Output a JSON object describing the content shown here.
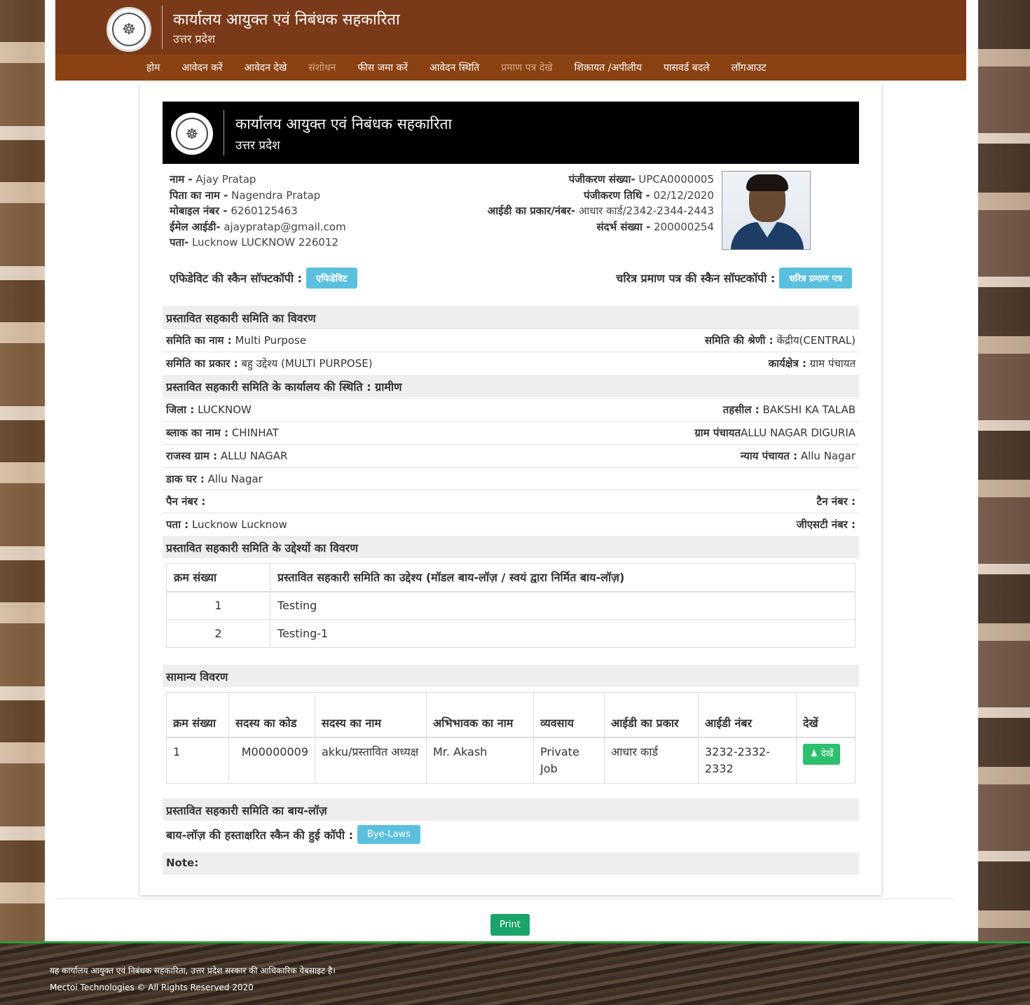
{
  "header": {
    "title": "कार्यालय आयुक्त एवं निबंधक सहकारिता",
    "subtitle": "उत्तर प्रदेश",
    "emblem_icon": "up-government-emblem"
  },
  "nav": [
    {
      "label": "होम",
      "dim": false
    },
    {
      "label": "आवेदन करें",
      "dim": false
    },
    {
      "label": "आवेदन देखे",
      "dim": false
    },
    {
      "label": "संशोधन",
      "dim": true
    },
    {
      "label": "फीस जमा करें",
      "dim": false
    },
    {
      "label": "आवेदन स्थिति",
      "dim": false
    },
    {
      "label": "प्रमाण पत्र देखे",
      "dim": true
    },
    {
      "label": "शिकायत /अपीलीय",
      "dim": false
    },
    {
      "label": "पासवर्ड बदले",
      "dim": false
    },
    {
      "label": "लॉगआउट",
      "dim": false
    }
  ],
  "card_header": {
    "title": "कार्यालय आयुक्त एवं निबंधक सहकारिता",
    "subtitle": "उत्तर प्रदेश"
  },
  "applicant": {
    "name_label": "नाम -",
    "name": "Ajay Pratap",
    "father_label": "पिता का नाम -",
    "father": "Nagendra Pratap",
    "mobile_label": "मोबाइल नंबर -",
    "mobile": "6260125463",
    "email_label": "ईमेल आईडी-",
    "email": "ajaypratap@gmail.com",
    "address_label": "पता-",
    "address": "Lucknow LUCKNOW 226012",
    "reg_no_label": "पंजीकरण संख्या-",
    "reg_no": "UPCA0000005",
    "reg_date_label": "पंजीकरण तिथि -",
    "reg_date": "02/12/2020",
    "id_label": "आईडी का प्रकार/नंबर-",
    "id_value": "आधार कार्ड/2342-2344-2443",
    "ref_label": "संदर्भ संख्या -",
    "ref_no": "200000254"
  },
  "scans": {
    "affidavit_label": "एफिडेविट की स्कैन सॉफ्टकॉपी :",
    "affidavit_button": "एफिडेविट",
    "character_label": "चरित्र प्रमाण पत्र की स्कैन सॉफ्टकॉपी :",
    "character_button": "चरित्र प्रमाण पत्र"
  },
  "society": {
    "section_title": "प्रस्तावित सहकारी समिति का विवरण",
    "name_label": "समिति का नाम :",
    "name": "Multi Purpose",
    "category_label": "समिति की श्रेणी :",
    "category": "केंद्रीय(CENTRAL)",
    "type_label": "समिति का प्रकार :",
    "type": "बहु उद्देश्य (MULTI PURPOSE)",
    "area_label": "कार्यक्षेत्र :",
    "area": "ग्राम पंचायत",
    "office_status": "प्रस्तावित सहकारी समिति के कार्यालय की स्थिति : ग्रामीण",
    "district_label": "जिला :",
    "district": "LUCKNOW",
    "tehsil_label": "तहसील :",
    "tehsil": "BAKSHI KA TALAB",
    "block_label": "ब्लाक का नाम :",
    "block": "CHINHAT",
    "gram_panchayat_label": "ग्राम पंचायत",
    "gram_panchayat": "ALLU NAGAR DIGURIA",
    "revenue_village_label": "राजस्व ग्राम :",
    "revenue_village": "ALLU NAGAR",
    "nyay_panchayat_label": "न्याय पंचायत :",
    "nyay_panchayat": "Allu Nagar",
    "post_office_label": "डाक घर :",
    "post_office": "Allu Nagar",
    "pan_label": "पैन नंबर :",
    "pan": "",
    "tan_label": "टैन नंबर :",
    "tan": "",
    "address_label": "पता :",
    "address": "Lucknow Lucknow",
    "gst_label": "जीएसटी नंबर :",
    "gst": ""
  },
  "objectives": {
    "section_title": "प्रस्तावित सहकारी समिति के उद्देश्यों का विवरण",
    "headers": [
      "क्रम संख्या",
      "प्रस्तावित सहकारी समिति का उद्देश्य (मॉडल बाय-लॉज़ / स्वयं द्वारा निर्मित बाय-लॉज़)"
    ],
    "rows": [
      {
        "sno": "1",
        "text": "Testing"
      },
      {
        "sno": "2",
        "text": "Testing-1"
      }
    ]
  },
  "general": {
    "section_title": "सामान्य विवरण",
    "headers": [
      "क्रम संख्या",
      "सदस्य का कोड",
      "सदस्य का नाम",
      "अभिभावक का नाम",
      "व्यवसाय",
      "आईडी का प्रकार",
      "आईडी नंबर",
      "देखें"
    ],
    "rows": [
      {
        "sno": "1",
        "code": "M00000009",
        "name": "akku/प्रस्तावित अध्यक्ष",
        "guardian": "Mr. Akash",
        "occupation": "Private Job",
        "id_type": "आधार कार्ड",
        "id_no": "3232-2332-2332",
        "view": "देखें"
      }
    ]
  },
  "bylaws": {
    "section_title": "प्रस्तावित सहकारी समिति का बाय-लॉज़",
    "label": "बाय-लॉज़ की हस्ताक्षरित स्कैन की हुई कॉपी :",
    "button": "Bye-Laws",
    "note": "Note:"
  },
  "print_button": "Print",
  "footer": {
    "line1": "यह कार्यालय आयुक्त एवं निबंधक सहकारिता, उत्तर प्रदेश सरकार की आधिकारिक वेबसाइट है।",
    "line2": "Mectoi Technologies © All Rights Reserved 2020"
  },
  "colors": {
    "header_bg": "#7a3a1a",
    "nav_bg": "#8b4212",
    "info_button": "#5bc0de",
    "success_button": "#2ec06f",
    "print_button": "#1aa36a"
  }
}
